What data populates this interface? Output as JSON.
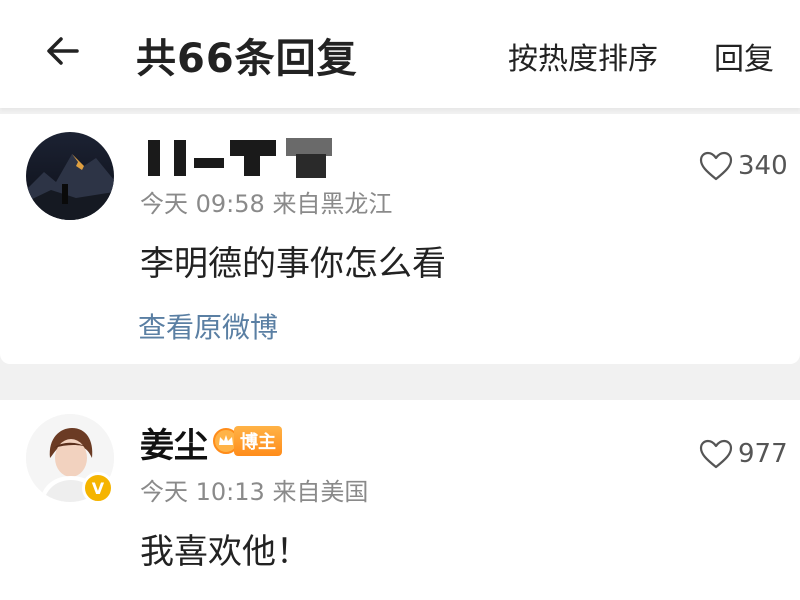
{
  "header": {
    "title": "共66条回复",
    "sort_label": "按热度排序",
    "reply_label": "回复"
  },
  "original_post": {
    "username": "",
    "time": "今天 09:58",
    "location": "来自黑龙江",
    "text": "李明德的事你怎么看",
    "link_label": "查看原微博",
    "like_count": "340"
  },
  "reply": {
    "username": "姜尘",
    "badge_label": "博主",
    "time": "今天 10:13",
    "location": "来自美国",
    "text": "我喜欢他！",
    "like_count": "977"
  },
  "icons": {
    "back": "back-arrow-icon",
    "like": "heart-outline-icon",
    "badge": "crown-icon",
    "verified": "verified-v-icon"
  }
}
